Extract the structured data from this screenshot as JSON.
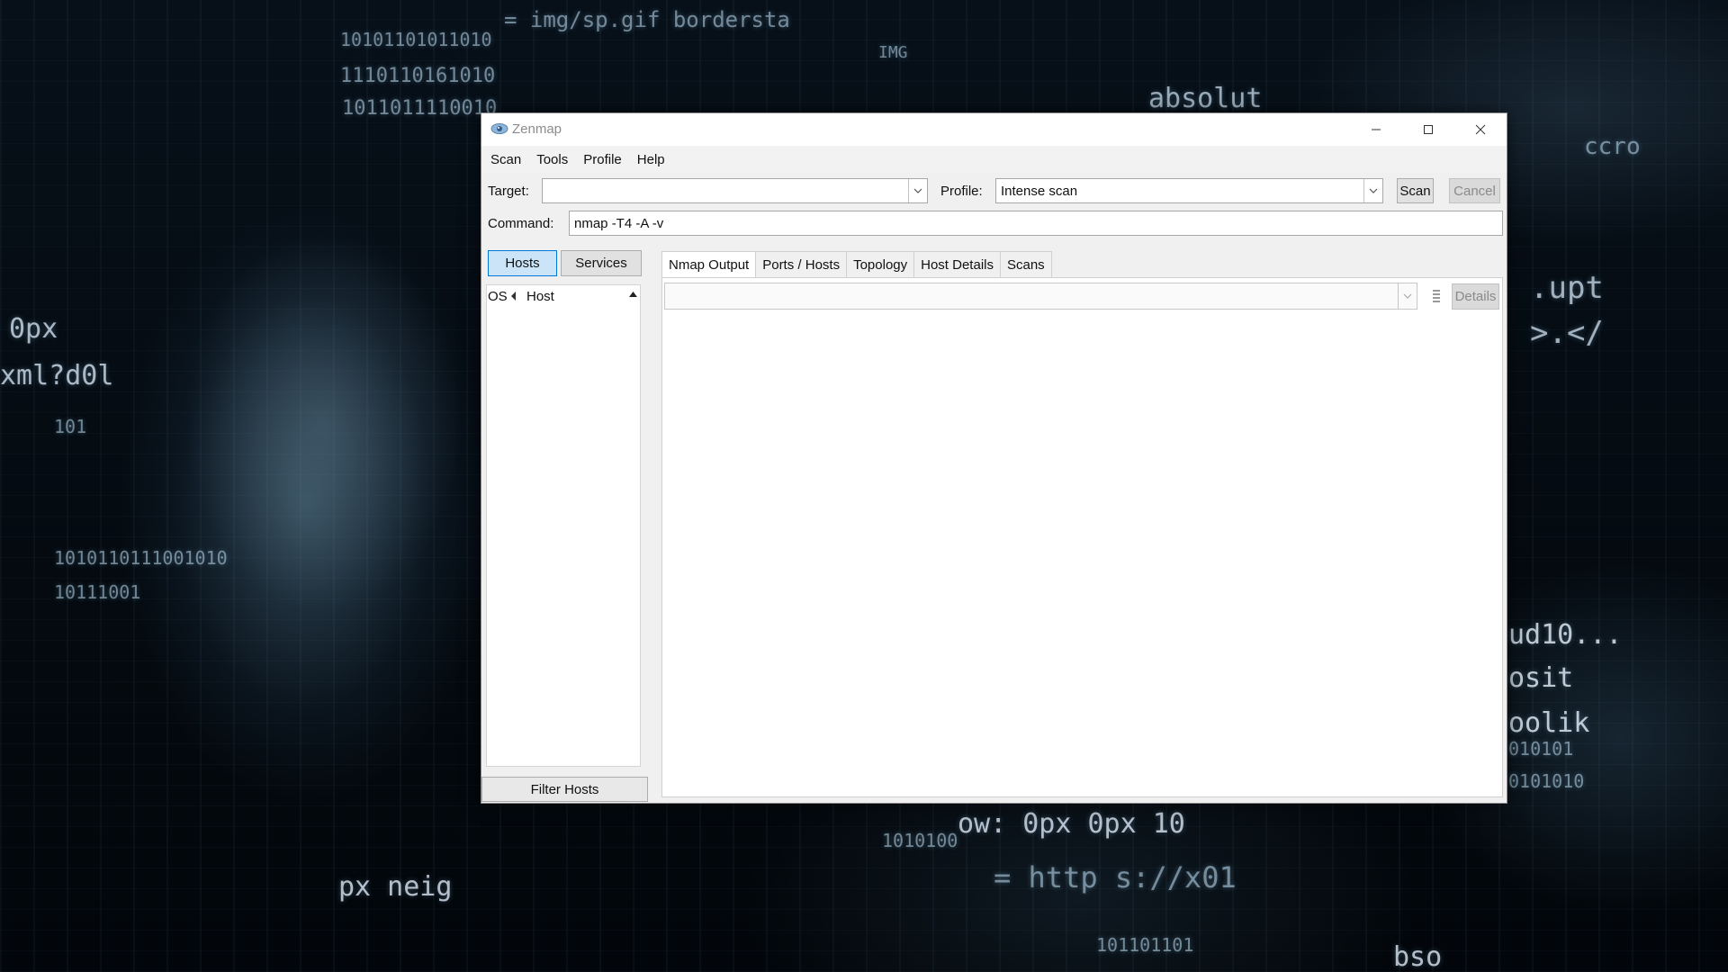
{
  "window": {
    "title": "Zenmap"
  },
  "menu": [
    "Scan",
    "Tools",
    "Profile",
    "Help"
  ],
  "toolbar": {
    "target_label": "Target:",
    "target_value": "",
    "profile_label": "Profile:",
    "profile_value": "Intense scan",
    "scan_label": "Scan",
    "cancel_label": "Cancel",
    "command_label": "Command:",
    "command_value": "nmap -T4 -A -v"
  },
  "left_panel": {
    "hosts_label": "Hosts",
    "services_label": "Services",
    "os_column": "OS",
    "host_column": "Host",
    "filter_label": "Filter Hosts"
  },
  "tabs": [
    "Nmap Output",
    "Ports / Hosts",
    "Topology",
    "Host Details",
    "Scans"
  ],
  "output": {
    "details_label": "Details"
  },
  "wallpaper_text": [
    "= img/sp.gif  bordersta",
    "10101101011010",
    "1110110161010",
    "1011011110010",
    "absolut",
    "0px",
    "xml?d0l",
    "101",
    "1010110111001010",
    "10111001",
    ".upt",
    ">.</",
    "ccro",
    "ud10...",
    "osit",
    "oolik",
    "010101",
    "0101010",
    "ow: 0px 0px 10",
    "px neig",
    "= http s://x01",
    "101101101",
    "bso",
    "IMG",
    "1010100"
  ],
  "colors": {
    "accent": "#0078d7",
    "window_bg": "#f0f0f0"
  }
}
